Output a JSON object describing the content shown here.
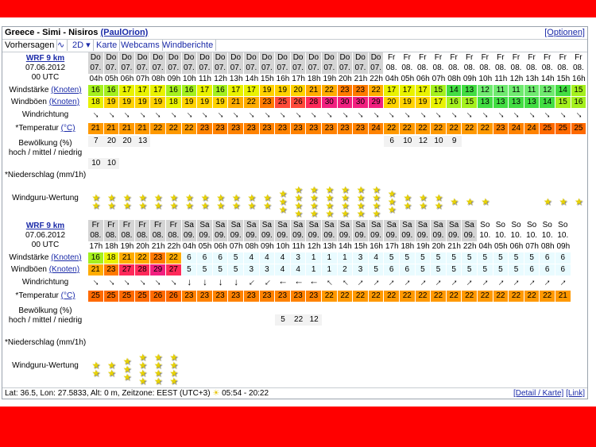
{
  "header": {
    "location": "Greece - Simi - Nisiros",
    "user": "(PaulOrion)",
    "options_link": "[Optionen]"
  },
  "tabs": [
    {
      "label": "Vorhersagen",
      "active": true
    },
    {
      "label": "2D"
    },
    {
      "label": "Karte"
    },
    {
      "label": "Webcams"
    },
    {
      "label": "Windberichte"
    }
  ],
  "icons": {
    "graph_tab": "graph-icon",
    "dropdown": "chevron-down-icon",
    "sun": "sun-icon",
    "star": "star-icon"
  },
  "colors": {
    "red_band": "#ff0000",
    "day_header_gray": "#d4d4d4"
  },
  "labels": {
    "model": "WRF 9 km",
    "date": "07.06.2012",
    "utc": "00 UTC",
    "wind_speed": "Windstärke",
    "wind_gusts": "Windböen",
    "unit_link": "(Knoten)",
    "direction": "Windrichtung",
    "temperature": "*Temperatur",
    "temp_unit": "(°C)",
    "clouds_line1": "Bewölkung (%)",
    "clouds_line2": "hoch / mittel / niedrig",
    "precip": "*Niederschlag (mm/1h)",
    "rating": "Windguru-Wertung"
  },
  "table1": {
    "days": [
      "Do",
      "Do",
      "Do",
      "Do",
      "Do",
      "Do",
      "Do",
      "Do",
      "Do",
      "Do",
      "Do",
      "Do",
      "Do",
      "Do",
      "Do",
      "Do",
      "Do",
      "Do",
      "Do",
      "Fr",
      "Fr",
      "Fr",
      "Fr",
      "Fr",
      "Fr",
      "Fr",
      "Fr",
      "Fr",
      "Fr",
      "Fr",
      "Fr",
      "Fr"
    ],
    "dates": [
      "07.",
      "07.",
      "07.",
      "07.",
      "07.",
      "07.",
      "07.",
      "07.",
      "07.",
      "07.",
      "07.",
      "07.",
      "07.",
      "07.",
      "07.",
      "07.",
      "07.",
      "07.",
      "07.",
      "08.",
      "08.",
      "08.",
      "08.",
      "08.",
      "08.",
      "08.",
      "08.",
      "08.",
      "08.",
      "08.",
      "08.",
      "08."
    ],
    "hours": [
      "04h",
      "05h",
      "06h",
      "07h",
      "08h",
      "09h",
      "10h",
      "11h",
      "12h",
      "13h",
      "14h",
      "15h",
      "16h",
      "17h",
      "18h",
      "19h",
      "20h",
      "21h",
      "22h",
      "04h",
      "05h",
      "06h",
      "07h",
      "08h",
      "09h",
      "10h",
      "11h",
      "12h",
      "13h",
      "14h",
      "15h",
      "16h"
    ],
    "wind": [
      16,
      16,
      17,
      17,
      17,
      16,
      16,
      17,
      16,
      17,
      17,
      19,
      19,
      20,
      21,
      22,
      23,
      23,
      22,
      17,
      17,
      17,
      15,
      14,
      13,
      12,
      11,
      11,
      11,
      12,
      14,
      15
    ],
    "gusts": [
      18,
      19,
      19,
      19,
      19,
      18,
      19,
      19,
      19,
      21,
      22,
      23,
      25,
      26,
      28,
      30,
      30,
      30,
      29,
      20,
      19,
      19,
      17,
      16,
      15,
      13,
      13,
      13,
      13,
      14,
      15,
      16
    ],
    "dir_angle": [
      135,
      135,
      135,
      135,
      135,
      135,
      135,
      135,
      135,
      135,
      135,
      135,
      135,
      135,
      135,
      135,
      135,
      135,
      135,
      135,
      135,
      135,
      135,
      135,
      135,
      135,
      135,
      135,
      135,
      135,
      135,
      135
    ],
    "temp": [
      21,
      21,
      21,
      21,
      22,
      22,
      22,
      23,
      23,
      23,
      23,
      23,
      23,
      23,
      23,
      23,
      23,
      23,
      24,
      22,
      22,
      22,
      22,
      22,
      22,
      22,
      23,
      24,
      24,
      25,
      25,
      25
    ],
    "clouds": [
      [
        "7",
        "20",
        "20",
        "13",
        "",
        "",
        "",
        "",
        "",
        "",
        "",
        "",
        "",
        "",
        "",
        "",
        "",
        "",
        "",
        "6",
        "10",
        "12",
        "10",
        "9",
        "",
        "",
        "",
        "",
        "",
        "",
        "",
        ""
      ],
      [
        "",
        "",
        "",
        "",
        "",
        "",
        "",
        "",
        "",
        "",
        "",
        "",
        "",
        "",
        "",
        "",
        "",
        "",
        "",
        "",
        "",
        "",
        "",
        "",
        "",
        "",
        "",
        "",
        "",
        "",
        "",
        ""
      ],
      [
        "10",
        "10",
        "",
        "",
        "",
        "",
        "",
        "",
        "",
        "",
        "",
        "",
        "",
        "",
        "",
        "",
        "",
        "",
        "",
        "",
        "",
        "",
        "",
        "",
        "",
        "",
        "",
        "",
        "",
        "",
        "",
        ""
      ]
    ],
    "stars": [
      2,
      2,
      2,
      2,
      2,
      2,
      2,
      2,
      2,
      2,
      2,
      2,
      3,
      4,
      4,
      4,
      4,
      4,
      4,
      3,
      2,
      2,
      2,
      1,
      1,
      1,
      0,
      0,
      0,
      1,
      1,
      1
    ]
  },
  "table2": {
    "days": [
      "Fr",
      "Fr",
      "Fr",
      "Fr",
      "Fr",
      "Fr",
      "Sa",
      "Sa",
      "Sa",
      "Sa",
      "Sa",
      "Sa",
      "Sa",
      "Sa",
      "Sa",
      "Sa",
      "Sa",
      "Sa",
      "Sa",
      "Sa",
      "Sa",
      "Sa",
      "Sa",
      "Sa",
      "Sa",
      "So",
      "So",
      "So",
      "So",
      "So",
      "So"
    ],
    "dates": [
      "08.",
      "08.",
      "08.",
      "08.",
      "08.",
      "08.",
      "09.",
      "09.",
      "09.",
      "09.",
      "09.",
      "09.",
      "09.",
      "09.",
      "09.",
      "09.",
      "09.",
      "09.",
      "09.",
      "09.",
      "09.",
      "09.",
      "09.",
      "09.",
      "09.",
      "10.",
      "10.",
      "10.",
      "10.",
      "10.",
      "10."
    ],
    "hours": [
      "17h",
      "18h",
      "19h",
      "20h",
      "21h",
      "22h",
      "04h",
      "05h",
      "06h",
      "07h",
      "08h",
      "09h",
      "10h",
      "11h",
      "12h",
      "13h",
      "14h",
      "15h",
      "16h",
      "17h",
      "18h",
      "19h",
      "20h",
      "21h",
      "22h",
      "04h",
      "05h",
      "06h",
      "07h",
      "08h",
      "09h"
    ],
    "wind": [
      16,
      18,
      21,
      22,
      23,
      22,
      6,
      6,
      6,
      5,
      4,
      4,
      4,
      3,
      1,
      1,
      1,
      3,
      4,
      5,
      5,
      5,
      5,
      5,
      5,
      5,
      5,
      5,
      5,
      6,
      6
    ],
    "gusts": [
      21,
      23,
      27,
      28,
      29,
      27,
      5,
      5,
      5,
      5,
      3,
      3,
      4,
      4,
      1,
      1,
      2,
      3,
      5,
      6,
      6,
      5,
      5,
      5,
      5,
      5,
      5,
      5,
      6,
      6,
      6
    ],
    "dir_angle": [
      135,
      135,
      135,
      135,
      135,
      135,
      180,
      180,
      180,
      180,
      225,
      225,
      270,
      270,
      270,
      315,
      315,
      45,
      45,
      45,
      45,
      45,
      45,
      45,
      45,
      45,
      45,
      45,
      45,
      45,
      45
    ],
    "temp": [
      25,
      25,
      25,
      25,
      26,
      26,
      23,
      23,
      23,
      23,
      23,
      23,
      23,
      23,
      23,
      22,
      22,
      22,
      22,
      22,
      22,
      22,
      22,
      22,
      22,
      22,
      22,
      22,
      22,
      22,
      21
    ],
    "clouds": [
      [
        "",
        "",
        "",
        "",
        "",
        "",
        "",
        "",
        "",
        "",
        "",
        "",
        "",
        "",
        "",
        "",
        "",
        "",
        "",
        "",
        "",
        "",
        "",
        "",
        "",
        "",
        "",
        "",
        "",
        "",
        ""
      ],
      [
        "",
        "",
        "",
        "",
        "",
        "",
        "",
        "",
        "",
        "",
        "",
        "",
        "5",
        "22",
        "12",
        "",
        "",
        "",
        "",
        "",
        "",
        "",
        "",
        "",
        "",
        "",
        "",
        "",
        "",
        "",
        ""
      ],
      [
        "",
        "",
        "",
        "",
        "",
        "",
        "",
        "",
        "",
        "",
        "",
        "",
        "",
        "",
        "",
        "",
        "",
        "",
        "",
        "",
        "",
        "",
        "",
        "",
        "",
        "",
        "",
        "",
        "",
        "",
        ""
      ]
    ],
    "stars": [
      2,
      2,
      3,
      4,
      4,
      4,
      0,
      0,
      0,
      0,
      0,
      0,
      0,
      0,
      0,
      0,
      0,
      0,
      0,
      0,
      0,
      0,
      0,
      0,
      0,
      0,
      0,
      0,
      0,
      0,
      0
    ]
  },
  "footer": {
    "coords": "Lat: 36.5, Lon: 27.5833, Alt: 0 m, Zeitzone: EEST (UTC+3)",
    "sun_times": "05:54 - 20:22",
    "detail_link": "[Detail / Karte]",
    "link": "[Link]"
  }
}
